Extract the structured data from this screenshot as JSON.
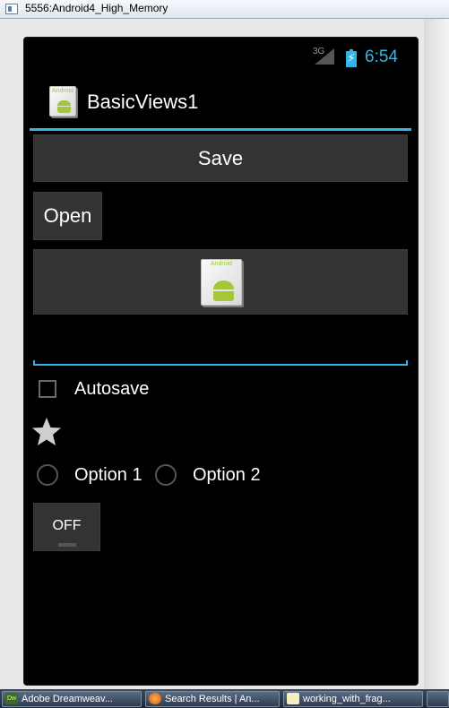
{
  "window": {
    "title": "5556:Android4_High_Memory",
    "icon": "emulator-window-icon"
  },
  "statusbar": {
    "network": "3G",
    "time": "6:54",
    "accent_color": "#33b5e5"
  },
  "actionbar": {
    "title": "BasicViews1",
    "icon": "android-app-icon"
  },
  "content": {
    "save_button": "Save",
    "open_button": "Open",
    "image_button_icon": "android-app-icon",
    "icon_tag": "Android",
    "edit_text_value": "",
    "checkbox_label": "Autosave",
    "checkbox_checked": false,
    "star_icon": "star-icon",
    "radio_1_label": "Option 1",
    "radio_2_label": "Option 2",
    "toggle_label": "OFF"
  },
  "taskbar": {
    "items": [
      {
        "label": "Adobe Dreamweav...",
        "icon": "Dw"
      },
      {
        "label": "Search Results | An...",
        "icon": "firefox-icon"
      },
      {
        "label": "working_with_frag...",
        "icon": "document-icon"
      }
    ]
  }
}
